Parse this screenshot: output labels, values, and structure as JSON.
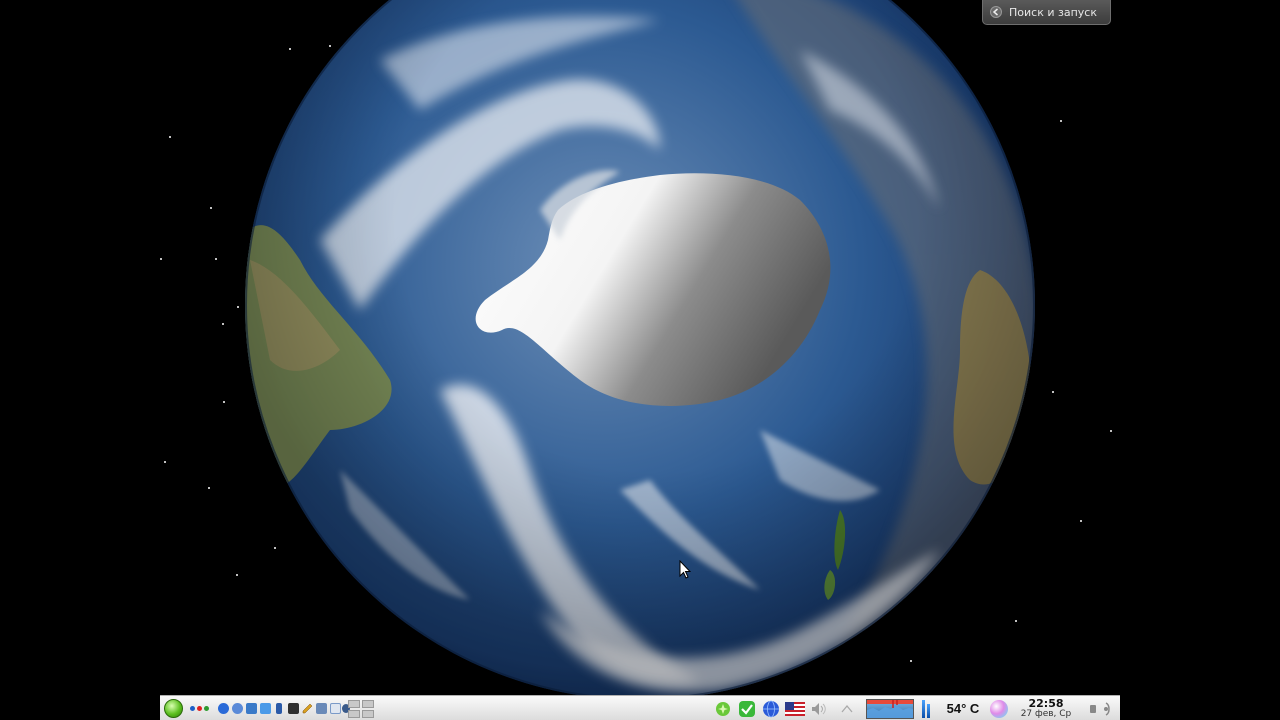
{
  "search_widget": {
    "label": "Поиск и запуск",
    "icon": "arrow-left-icon"
  },
  "taskbar": {
    "start_icon": "kde-kicker-icon",
    "dots_colors": [
      "#1e5fc8",
      "#e02020",
      "#2e9a2e"
    ],
    "quick_launch": [
      {
        "icon": "konqueror-icon",
        "color": "#2a6ad8"
      },
      {
        "icon": "kopete-icon",
        "color": "#5a8ad8"
      },
      {
        "icon": "network-icon",
        "color": "#3a7ac8"
      },
      {
        "icon": "printer-icon",
        "color": "#4a9ae8"
      },
      {
        "icon": "phone-icon",
        "color": "#2a5aa8"
      },
      {
        "icon": "terminal-icon",
        "color": "#303030"
      },
      {
        "icon": "pen-icon",
        "color": "#d8a020"
      },
      {
        "icon": "calculator-icon",
        "color": "#6a8ab8"
      },
      {
        "icon": "document-icon",
        "color": "#7a9ac8"
      },
      {
        "icon": "globe-icon",
        "color": "#3a5a8a"
      }
    ],
    "tray": {
      "update_icon": "update-notifier-icon",
      "check_icon": "checkmark-icon",
      "network_icon": "network-globe-icon",
      "keyboard_layout_icon": "us-flag-icon",
      "volume_icon": "volume-icon",
      "expand_icon": "chevron-up-icon"
    },
    "temperature": "54° C",
    "clock": {
      "time": "22:58",
      "date": "27 фев, Ср"
    },
    "colors": {
      "accent_green": "#5cbf1f",
      "bar_blue": "#2a6aa8"
    }
  }
}
